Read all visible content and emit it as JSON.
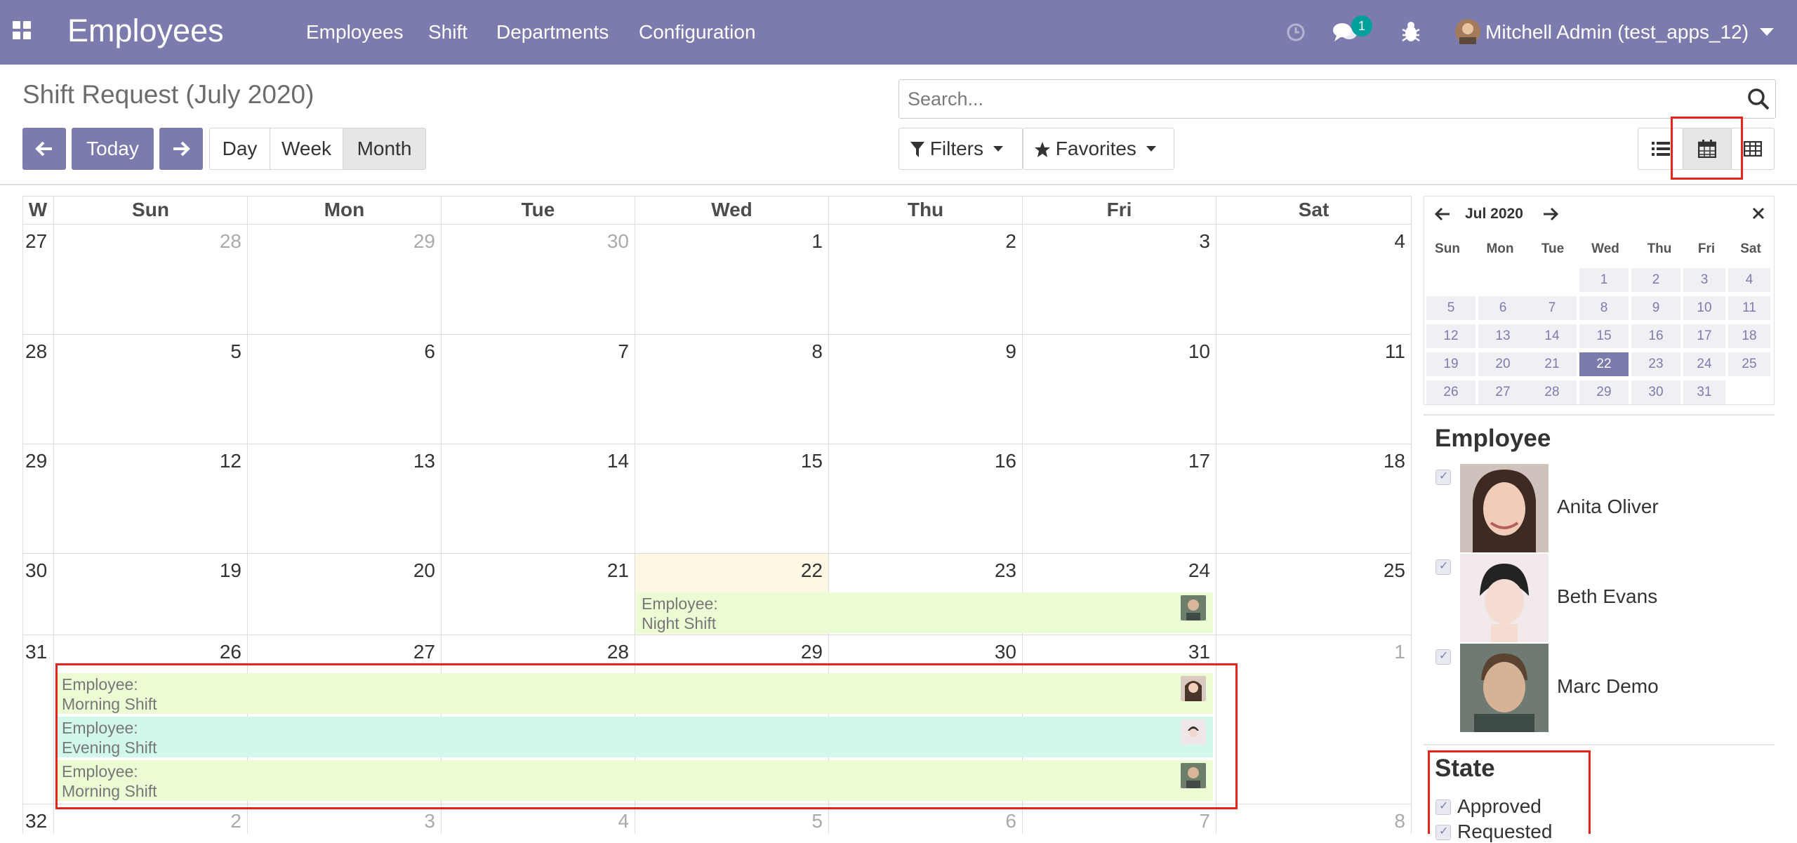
{
  "navbar": {
    "app_title": "Employees",
    "menu": [
      "Employees",
      "Shift",
      "Departments",
      "Configuration"
    ],
    "chat_badge": "1",
    "user": "Mitchell Admin (test_apps_12)"
  },
  "control_panel": {
    "title": "Shift Request (July 2020)",
    "search_placeholder": "Search...",
    "today_label": "Today",
    "scales": [
      "Day",
      "Week",
      "Month"
    ],
    "active_scale": "Month",
    "filters_label": "Filters",
    "favorites_label": "Favorites"
  },
  "calendar": {
    "week_col_header": "W",
    "day_headers": [
      "Sun",
      "Mon",
      "Tue",
      "Wed",
      "Thu",
      "Fri",
      "Sat"
    ],
    "weeks": [
      {
        "num": "27",
        "days": [
          "28",
          "29",
          "30",
          "1",
          "2",
          "3",
          "4"
        ]
      },
      {
        "num": "28",
        "days": [
          "5",
          "6",
          "7",
          "8",
          "9",
          "10",
          "11"
        ]
      },
      {
        "num": "29",
        "days": [
          "12",
          "13",
          "14",
          "15",
          "16",
          "17",
          "18"
        ]
      },
      {
        "num": "30",
        "days": [
          "19",
          "20",
          "21",
          "22",
          "23",
          "24",
          "25"
        ]
      },
      {
        "num": "31",
        "days": [
          "26",
          "27",
          "28",
          "29",
          "30",
          "31",
          "1"
        ]
      },
      {
        "num": "32",
        "days": [
          "2",
          "3",
          "4",
          "5",
          "6",
          "7",
          "8"
        ]
      }
    ],
    "events": [
      {
        "line1": "Employee:",
        "line2": "Night Shift"
      },
      {
        "line1": "Employee:",
        "line2": "Morning Shift"
      },
      {
        "line1": "Employee:",
        "line2": "Evening Shift"
      },
      {
        "line1": "Employee:",
        "line2": "Morning Shift"
      }
    ]
  },
  "mini_calendar": {
    "month_label": "Jul 2020",
    "dow": [
      "Sun",
      "Mon",
      "Tue",
      "Wed",
      "Thu",
      "Fri",
      "Sat"
    ],
    "rows": [
      [
        "",
        "",
        "",
        "1",
        "2",
        "3",
        "4"
      ],
      [
        "5",
        "6",
        "7",
        "8",
        "9",
        "10",
        "11"
      ],
      [
        "12",
        "13",
        "14",
        "15",
        "16",
        "17",
        "18"
      ],
      [
        "19",
        "20",
        "21",
        "22",
        "23",
        "24",
        "25"
      ],
      [
        "26",
        "27",
        "28",
        "29",
        "30",
        "31",
        ""
      ]
    ],
    "selected": "22"
  },
  "filters_panel": {
    "employee_title": "Employee",
    "employees": [
      "Anita Oliver",
      "Beth Evans",
      "Marc Demo"
    ],
    "state_title": "State",
    "states": [
      "Approved",
      "Requested"
    ]
  },
  "colors": {
    "brand": "#7c7bad",
    "event_green": "#ebfbd4",
    "event_teal": "#d2f8ec",
    "today_bg": "#fcf8e3",
    "highlight_red": "#e3261c"
  }
}
